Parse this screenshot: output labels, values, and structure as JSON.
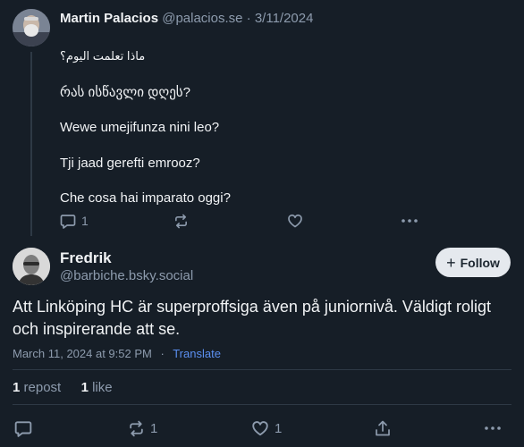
{
  "parent_post": {
    "author_name": "Martin Palacios",
    "author_handle": "@palacios.se",
    "separator": "·",
    "date": "3/11/2024",
    "lines": [
      "ماذا تعلمت اليوم؟",
      "რას ისწავლი დღეს?",
      "Wewe umejifunza nini leo?",
      "Tji jaad gerefti emrooz?",
      "Che cosa hai imparato oggi?"
    ],
    "actions": {
      "reply_count": "1",
      "icons": [
        "reply-icon",
        "repost-icon",
        "like-icon",
        "more-icon"
      ]
    }
  },
  "main_post": {
    "author_name": "Fredrik",
    "author_handle": "@barbiche.bsky.social",
    "follow_label": "Follow",
    "follow_plus": "+",
    "text": "Att Linköping HC är superproffsiga även på juniornivå. Väldigt roligt och inspirerande att se.",
    "timestamp": "March 11, 2024 at 9:52 PM",
    "meta_separator": "·",
    "translate_label": "Translate",
    "engagement": {
      "repost_count": "1",
      "repost_label": "repost",
      "like_count": "1",
      "like_label": "like"
    },
    "actions": {
      "repost_count": "1",
      "like_count": "1",
      "icons": [
        "reply-icon",
        "repost-icon",
        "like-icon",
        "share-icon",
        "more-icon"
      ]
    }
  },
  "colors": {
    "background": "#161e27",
    "text": "#f1f3f5",
    "muted": "#8d9bad",
    "link": "#5b8ff0",
    "follow_button_bg": "#e5e9ee",
    "divider": "#2e3945"
  }
}
